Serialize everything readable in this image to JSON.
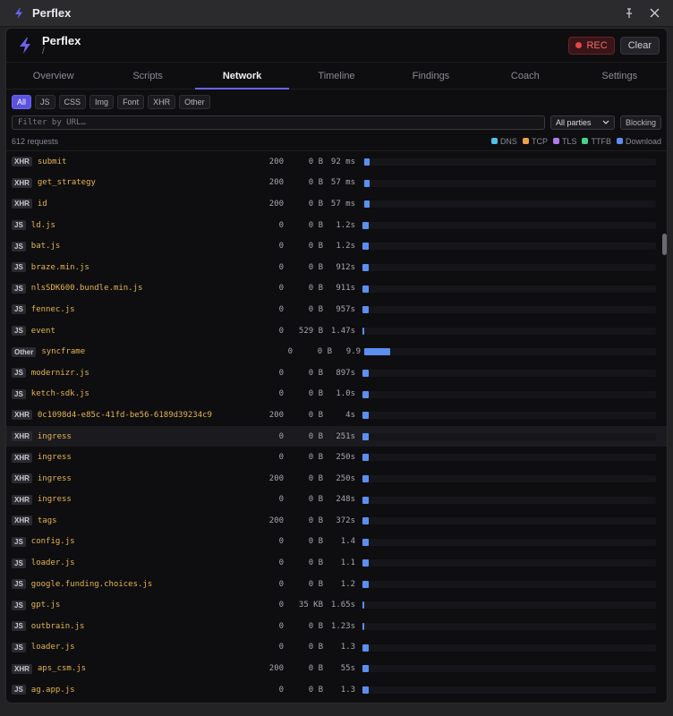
{
  "window": {
    "title": "Perflex",
    "pin_icon": "pin-icon",
    "close_icon": "close-icon"
  },
  "header": {
    "brand": "Perflex",
    "path": "/",
    "rec_label": "REC",
    "clear_label": "Clear",
    "accent": "#6b63f0"
  },
  "tabs": [
    {
      "label": "Overview"
    },
    {
      "label": "Scripts"
    },
    {
      "label": "Network",
      "active": true
    },
    {
      "label": "Timeline"
    },
    {
      "label": "Findings"
    },
    {
      "label": "Coach"
    },
    {
      "label": "Settings"
    }
  ],
  "filters": [
    {
      "label": "All",
      "active": true
    },
    {
      "label": "JS"
    },
    {
      "label": "CSS"
    },
    {
      "label": "Img"
    },
    {
      "label": "Font"
    },
    {
      "label": "XHR"
    },
    {
      "label": "Other"
    }
  ],
  "search": {
    "placeholder": "Filter by URL…",
    "value": ""
  },
  "parties": {
    "selected": "All parties"
  },
  "blocking_label": "Blocking",
  "summary": {
    "count": "612 requests"
  },
  "legend": [
    {
      "label": "DNS",
      "color": "#4fc3e8"
    },
    {
      "label": "TCP",
      "color": "#f0a04a"
    },
    {
      "label": "TLS",
      "color": "#b07ae8"
    },
    {
      "label": "TTFB",
      "color": "#4ad08a"
    },
    {
      "label": "Download",
      "color": "#5b8ff0"
    }
  ],
  "requests": [
    {
      "type": "XHR",
      "url": "submit",
      "status": "200",
      "size": "0 B",
      "time": "92 ms",
      "start": 0.005,
      "dur": 0.02
    },
    {
      "type": "XHR",
      "url": "get_strategy",
      "status": "200",
      "size": "0 B",
      "time": "57 ms",
      "start": 0.005,
      "dur": 0.02
    },
    {
      "type": "XHR",
      "url": "id",
      "status": "200",
      "size": "0 B",
      "time": "57 ms",
      "start": 0.005,
      "dur": 0.02
    },
    {
      "type": "JS",
      "url": "ld.js",
      "status": "0",
      "size": "0 B",
      "time": "1.2s",
      "start": 0.0,
      "dur": 0.02
    },
    {
      "type": "JS",
      "url": "bat.js",
      "status": "0",
      "size": "0 B",
      "time": "1.2s",
      "start": 0.0,
      "dur": 0.02
    },
    {
      "type": "JS",
      "url": "braze.min.js",
      "status": "0",
      "size": "0 B",
      "time": "912s",
      "start": 0.0,
      "dur": 0.02
    },
    {
      "type": "JS",
      "url": "nlsSDK600.bundle.min.js",
      "status": "0",
      "size": "0 B",
      "time": "911s",
      "start": 0.0,
      "dur": 0.02
    },
    {
      "type": "JS",
      "url": "fennec.js",
      "status": "0",
      "size": "0 B",
      "time": "957s",
      "start": 0.0,
      "dur": 0.02
    },
    {
      "type": "JS",
      "url": "event",
      "status": "0",
      "size": "529 B",
      "time": "1.47s",
      "start": 0.0,
      "dur": 0.005
    },
    {
      "type": "Other",
      "url": "syncframe",
      "status": "0",
      "size": "0 B",
      "time": "9.9",
      "start": 0.005,
      "dur": 0.09
    },
    {
      "type": "JS",
      "url": "modernizr.js",
      "status": "0",
      "size": "0 B",
      "time": "897s",
      "start": 0.0,
      "dur": 0.02
    },
    {
      "type": "JS",
      "url": "ketch-sdk.js",
      "status": "0",
      "size": "0 B",
      "time": "1.0s",
      "start": 0.0,
      "dur": 0.02
    },
    {
      "type": "XHR",
      "url": "0c1098d4-e85c-41fd-be56-6189d39234c9",
      "status": "200",
      "size": "0 B",
      "time": "4s",
      "start": 0.0,
      "dur": 0.02
    },
    {
      "type": "XHR",
      "url": "ingress",
      "status": "0",
      "size": "0 B",
      "time": "251s",
      "start": 0.0,
      "dur": 0.02,
      "highlight": true
    },
    {
      "type": "XHR",
      "url": "ingress",
      "status": "0",
      "size": "0 B",
      "time": "250s",
      "start": 0.0,
      "dur": 0.02
    },
    {
      "type": "XHR",
      "url": "ingress",
      "status": "200",
      "size": "0 B",
      "time": "250s",
      "start": 0.0,
      "dur": 0.02
    },
    {
      "type": "XHR",
      "url": "ingress",
      "status": "0",
      "size": "0 B",
      "time": "248s",
      "start": 0.0,
      "dur": 0.02
    },
    {
      "type": "XHR",
      "url": "tags",
      "status": "200",
      "size": "0 B",
      "time": "372s",
      "start": 0.0,
      "dur": 0.02
    },
    {
      "type": "JS",
      "url": "config.js",
      "status": "0",
      "size": "0 B",
      "time": "1.4",
      "start": 0.0,
      "dur": 0.02
    },
    {
      "type": "JS",
      "url": "loader.js",
      "status": "0",
      "size": "0 B",
      "time": "1.1",
      "start": 0.0,
      "dur": 0.02
    },
    {
      "type": "JS",
      "url": "google.funding.choices.js",
      "status": "0",
      "size": "0 B",
      "time": "1.2",
      "start": 0.0,
      "dur": 0.02
    },
    {
      "type": "JS",
      "url": "gpt.js",
      "status": "0",
      "size": "35 KB",
      "time": "1.65s",
      "start": 0.0,
      "dur": 0.005
    },
    {
      "type": "JS",
      "url": "outbrain.js",
      "status": "0",
      "size": "0 B",
      "time": "1.23s",
      "start": 0.0,
      "dur": 0.005
    },
    {
      "type": "JS",
      "url": "loader.js",
      "status": "0",
      "size": "0 B",
      "time": "1.3",
      "start": 0.0,
      "dur": 0.02
    },
    {
      "type": "XHR",
      "url": "aps_csm.js",
      "status": "200",
      "size": "0 B",
      "time": "55s",
      "start": 0.0,
      "dur": 0.02
    },
    {
      "type": "JS",
      "url": "ag.app.js",
      "status": "0",
      "size": "0 B",
      "time": "1.3",
      "start": 0.0,
      "dur": 0.02
    }
  ],
  "scroll": {
    "position": 0.15
  }
}
